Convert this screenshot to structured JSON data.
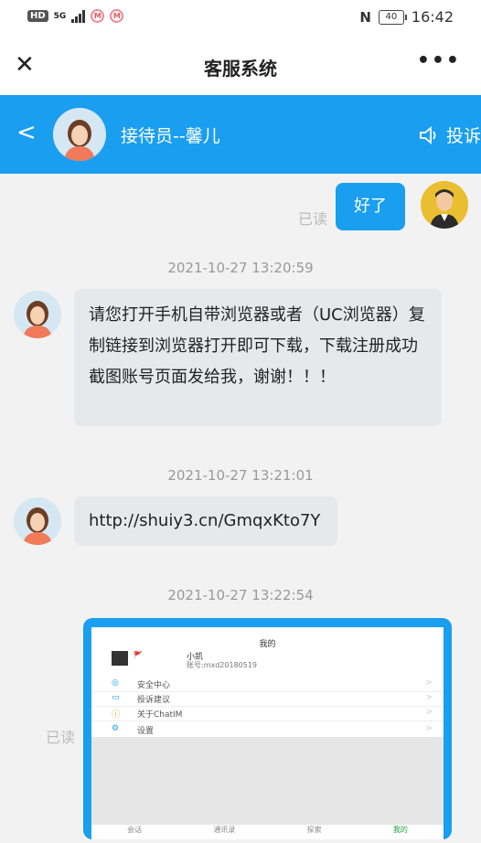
{
  "status_bar": {
    "hd": "HD",
    "network": "5G",
    "battery": "40",
    "time": "16:42"
  },
  "header": {
    "title": "客服系统",
    "more": "•••"
  },
  "agent_bar": {
    "name": "接待员--馨儿",
    "complain": "投诉"
  },
  "messages": {
    "user_reply": "好了",
    "read_label_1": "已读",
    "time_1": "2021-10-27 13:20:59",
    "agent_msg_1": "请您打开手机自带浏览器或者（UC浏览器）复制链接到浏览器打开即可下载，下载注册成功截图账号页面发给我，谢谢！！！",
    "time_2": "2021-10-27 13:21:01",
    "agent_msg_2": "http://shuiy3.cn/GmqxKto7Y",
    "time_3": "2021-10-27 13:22:54",
    "read_label_2": "已读"
  },
  "screenshot_image": {
    "page_title": "我的",
    "user_name": "小凯",
    "account": "账号:mxd20180519",
    "menu": [
      "安全中心",
      "投诉建议",
      "关于ChatIM",
      "设置"
    ],
    "tabs": [
      "会话",
      "通讯录",
      "探索",
      "我的"
    ]
  },
  "colors": {
    "accent": "#1a9ef0",
    "page_bg": "#f2f2f2",
    "agent_bubble": "#e6e8ea"
  }
}
